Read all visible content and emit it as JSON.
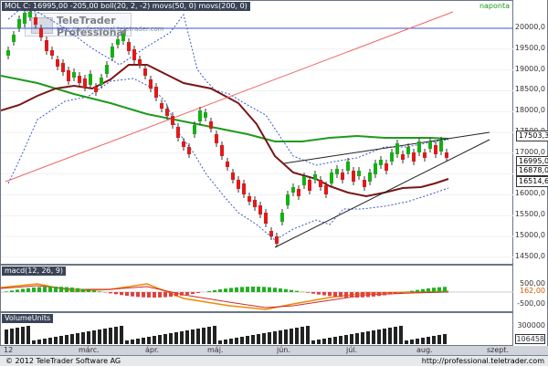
{
  "header": {
    "main": "MOL C: 16995,00  -205,00 boll(20, 2, -2) movs(50, 0) movs(200, 0)",
    "timeframe": "naponta",
    "macd": "macd(12, 26, 9)",
    "volume": "VolumeUnits"
  },
  "watermark": {
    "brand": "TeleTrader Professional",
    "url": "http://professional.teletrader.com"
  },
  "price_labels": [
    "20000,0",
    "19500,0",
    "19000,0",
    "18500,0",
    "18000,0",
    "17500,0",
    "17000,0",
    "16500,0",
    "16000,0",
    "15500,0",
    "15000,0",
    "14500,0"
  ],
  "price_boxes": {
    "ma200": "17503,35",
    "close": "16995,00",
    "low": "16878,00",
    "ma50": "16514,60"
  },
  "macd_labels": [
    "500,00",
    "162,00",
    "-500,00"
  ],
  "volume_labels": [
    "300000",
    "106458"
  ],
  "x_labels": [
    "12",
    "márc.",
    "ápr.",
    "máj.",
    "jún.",
    "júl.",
    "aug.",
    "szept."
  ],
  "footer": {
    "copyright": "© 2012 TeleTrader Software AG",
    "url": "http://professional.teletrader.com"
  },
  "colors": {
    "up": "#14b014",
    "down": "#e01a1a",
    "ma50": "#7a1616",
    "ma200": "#1d9a1d",
    "trend": "#e66",
    "bollinger": "#3b56c7"
  },
  "chart_data": {
    "type": "line",
    "series": [
      {
        "name": "ma200",
        "x": [
          "12",
          "márc.",
          "ápr.",
          "máj.",
          "jún.",
          "júl.",
          "aug."
        ],
        "values": [
          19100,
          18700,
          18300,
          17950,
          17620,
          17520,
          17500
        ]
      },
      {
        "name": "ma50",
        "x": [
          "12",
          "márc.",
          "ápr.",
          "máj.",
          "jún.",
          "júl.",
          "aug."
        ],
        "values": [
          18600,
          18900,
          19200,
          18400,
          16600,
          16100,
          16514
        ]
      }
    ],
    "ylim": [
      14500,
      20500
    ],
    "grid": true
  }
}
